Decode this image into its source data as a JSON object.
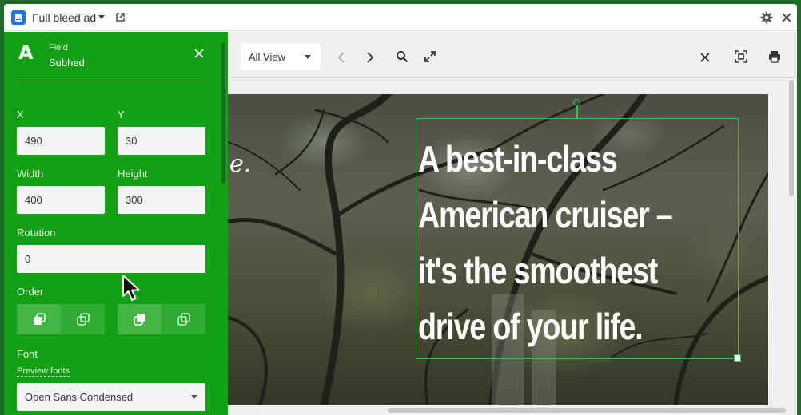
{
  "window": {
    "title": "Full bleed ad"
  },
  "panel": {
    "head_icon": "A",
    "head_subtitle": "Field",
    "head_title": "Subhed",
    "x_label": "X",
    "x_value": "490",
    "y_label": "Y",
    "y_value": "30",
    "width_label": "Width",
    "width_value": "400",
    "height_label": "Height",
    "height_value": "300",
    "rotation_label": "Rotation",
    "rotation_value": "0",
    "order_label": "Order",
    "font_label": "Font",
    "preview_fonts_link": "Preview fonts",
    "font_value": "Open Sans Condensed"
  },
  "toolbar": {
    "view_select": "All View"
  },
  "canvas": {
    "script_fragment": "e.",
    "headline_lines": [
      "A best-in-class",
      "American cruiser –",
      "it's the smoothest",
      "drive of your life."
    ]
  },
  "colors": {
    "panel_green": "#14a015",
    "selection_green": "#35c24b",
    "accent_blue": "#1f73e8"
  },
  "icons": [
    "document-icon",
    "chevron-down-icon",
    "open-external-icon",
    "gear-icon",
    "close-icon",
    "text-field-icon",
    "bring-forward-icon",
    "send-backward-icon",
    "chevron-left-icon",
    "chevron-right-icon",
    "search-icon",
    "expand-icon",
    "fit-screen-icon",
    "print-icon",
    "mouse-cursor-icon"
  ]
}
